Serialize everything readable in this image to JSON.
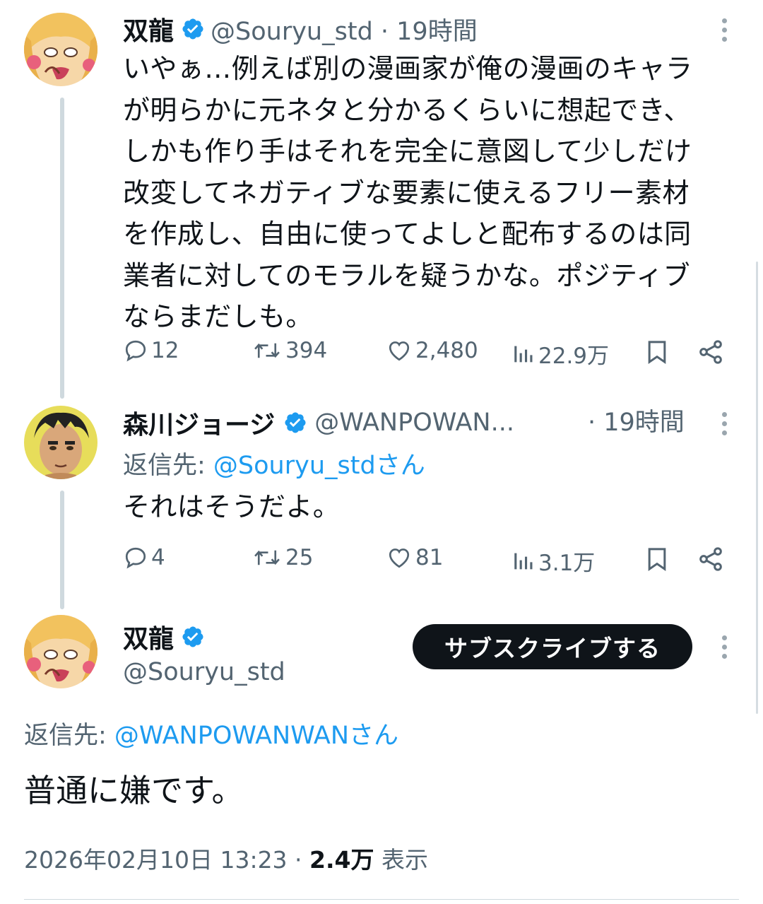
{
  "colors": {
    "link": "#1d9bf0",
    "muted": "#536471",
    "text": "#0f1419",
    "verified": "#1d9bf0",
    "thread_line": "#cfd9de"
  },
  "tweet1": {
    "name": "双龍",
    "handle_time": "@Souryu_std · 19時間",
    "lines": [
      "いやぁ…例えば別の漫画家が俺の漫画のキャラ",
      "が明らかに元ネタと分かるくらいに想起でき、",
      "しかも作り手はそれを完全に意図して少しだけ",
      "改変してネガティブな要素に使えるフリー素材",
      "を作成し、自由に使ってよしと配布するのは同",
      "業者に対してのモラルを疑うかな。ポジティブ",
      "ならまだしも。"
    ],
    "actions": {
      "replies": "12",
      "reposts": "394",
      "likes": "2,480",
      "views": "22.9万"
    }
  },
  "tweet2": {
    "name": "森川ジョージ",
    "handle": "@WANPOWAN...",
    "time": "· 19時間",
    "reply_to_label": "返信先: ",
    "reply_to_mention": "@Souryu_stdさん",
    "text": "それはそうだよ。",
    "actions": {
      "replies": "4",
      "reposts": "25",
      "likes": "81",
      "views": "3.1万"
    }
  },
  "tweet3": {
    "name": "双龍",
    "handle": "@Souryu_std",
    "subscribe_label": "サブスクライブする",
    "reply_to_label": "返信先: ",
    "reply_to_mention": "@WANPOWANWANさん",
    "text": "普通に嫌です。",
    "timestamp": "2026年02月10日 13:23 · ",
    "views_count": "2.4万",
    "views_label": " 表示"
  },
  "icons": [
    "verified-badge-icon",
    "more-options-icon",
    "reply-icon",
    "repost-icon",
    "like-icon",
    "views-icon",
    "bookmark-icon",
    "share-icon"
  ]
}
